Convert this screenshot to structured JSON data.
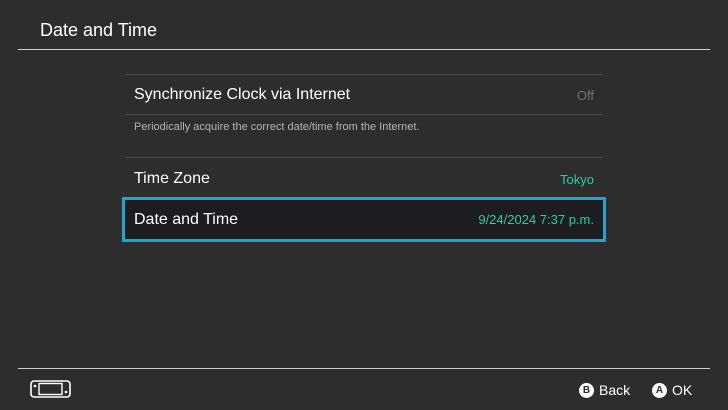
{
  "header": {
    "title": "Date and Time"
  },
  "settings": {
    "sync": {
      "label": "Synchronize Clock via Internet",
      "value": "Off",
      "description": "Periodically acquire the correct date/time from the Internet."
    },
    "time_zone": {
      "label": "Time Zone",
      "value": "Tokyo"
    },
    "date_time": {
      "label": "Date and Time",
      "value": "9/24/2024 7:37 p.m."
    }
  },
  "footer": {
    "device_icon": "handheld-console-icon",
    "back": {
      "glyph": "B",
      "label": "Back"
    },
    "ok": {
      "glyph": "A",
      "label": "OK"
    }
  },
  "colors": {
    "background": "#2d2d2d",
    "accent": "#1fd3a8",
    "selection_border": "#1fa6cc",
    "selection_fill": "#1d1d1f",
    "muted": "#727272"
  }
}
